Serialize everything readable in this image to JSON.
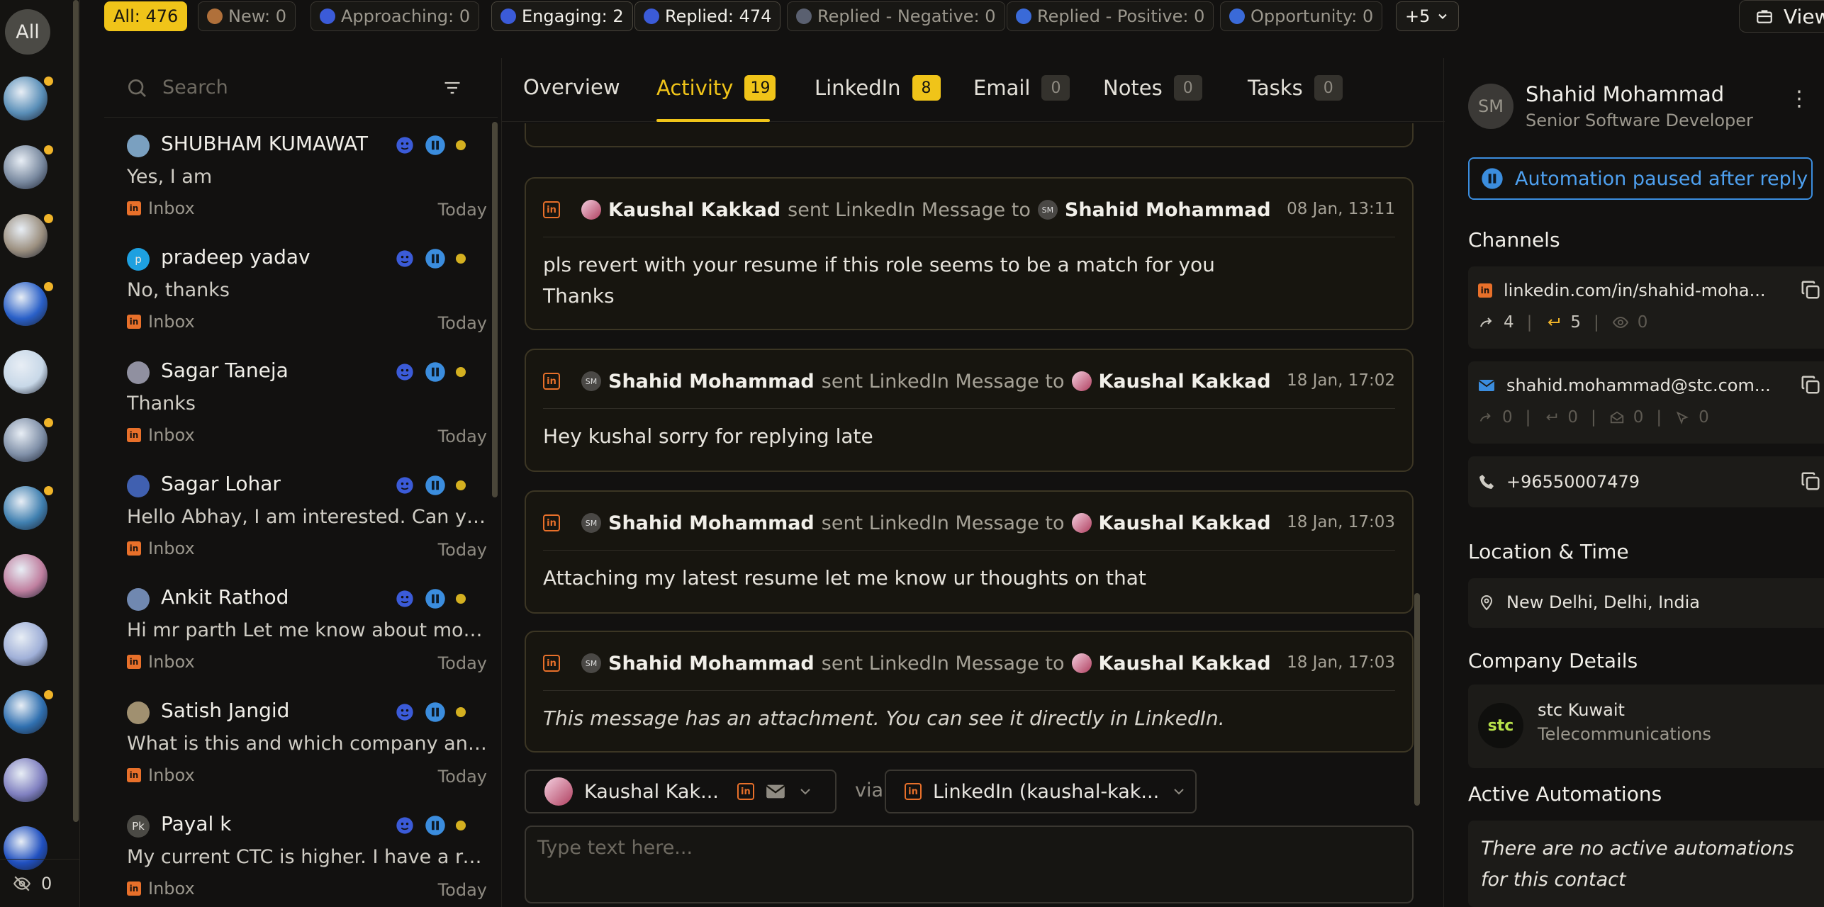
{
  "rail": {
    "all_label": "All",
    "avatars": [
      {
        "color": "#5a8fb8",
        "dot": true
      },
      {
        "color": "#7a8aa0",
        "dot": true
      },
      {
        "color": "#9c9080",
        "dot": true
      },
      {
        "color": "#2a60c8",
        "dot": true
      },
      {
        "color": "#c8d8e8",
        "dot": false
      },
      {
        "color": "#8090a8",
        "dot": true
      },
      {
        "color": "#4080b0",
        "dot": true
      },
      {
        "color": "#c080a0",
        "dot": false
      },
      {
        "color": "#a0b0d8",
        "dot": false
      },
      {
        "color": "#3070b0",
        "dot": true
      },
      {
        "color": "#8080c0",
        "dot": false
      },
      {
        "color": "#2050c0",
        "dot": false
      }
    ],
    "hidden_count": "0"
  },
  "filters": [
    {
      "label": "All: 476",
      "state": "active"
    },
    {
      "label": "New: 0",
      "state": "dim"
    },
    {
      "label": "Approaching: 0",
      "state": "dim"
    },
    {
      "label": "Engaging: 2",
      "state": "bright"
    },
    {
      "label": "Replied: 474",
      "state": "bright"
    },
    {
      "label": "Replied - Negative: 0",
      "state": "dim"
    },
    {
      "label": "Replied - Positive: 0",
      "state": "dim"
    },
    {
      "label": "Opportunity: 0",
      "state": "dim"
    },
    {
      "label": "+5",
      "state": "bright"
    }
  ],
  "crm_button": "View in CRM",
  "search": {
    "placeholder": "Search"
  },
  "conversations": [
    {
      "name": "SHUBHAM KUMAWAT",
      "message": "Yes, I am",
      "source": "Inbox",
      "time": "Today",
      "avatar_color": "#7aa0c0"
    },
    {
      "name": "pradeep yadav",
      "message": "No, thanks",
      "source": "Inbox",
      "time": "Today",
      "avatar_color": "#1ea0e0",
      "initial": "p"
    },
    {
      "name": "Sagar Taneja",
      "message": "Thanks",
      "source": "Inbox",
      "time": "Today",
      "avatar_color": "#9090a0"
    },
    {
      "name": "Sagar Lohar",
      "message": "Hello Abhay, I am interested. Can you share more details?",
      "source": "Inbox",
      "time": "Today",
      "avatar_color": "#4060b0"
    },
    {
      "name": "Ankit Rathod",
      "message": "Hi mr parth Let me know about more details",
      "source": "Inbox",
      "time": "Today",
      "avatar_color": "#7088b0"
    },
    {
      "name": "Satish Jangid",
      "message": "What is this and which company and role is it for?",
      "source": "Inbox",
      "time": "Today",
      "avatar_color": "#a09070"
    },
    {
      "name": "Payal k",
      "message": "My current CTC is higher. I have a role in mind",
      "source": "Inbox",
      "time": "Today",
      "avatar_color": "#4b4a45",
      "initial": "Pk"
    }
  ],
  "tabs": [
    {
      "label": "Overview",
      "count": null,
      "active": false
    },
    {
      "label": "Activity",
      "count": "19",
      "active": true
    },
    {
      "label": "LinkedIn",
      "count": "8",
      "active": false
    },
    {
      "label": "Email",
      "count": "0",
      "active": false
    },
    {
      "label": "Notes",
      "count": "0",
      "active": false
    },
    {
      "label": "Tasks",
      "count": "0",
      "active": false
    }
  ],
  "activity": [
    {
      "from": "Kaushal Kakkad",
      "verb": "sent LinkedIn Message to",
      "to": "Shahid Mohammad",
      "date": "08 Jan, 13:11",
      "from_kind": "kk",
      "to_kind": "sm",
      "body": [
        "pls revert with your resume if this role seems to be a match for you",
        "Thanks"
      ],
      "italic": false
    },
    {
      "from": "Shahid Mohammad",
      "verb": "sent LinkedIn Message to",
      "to": "Kaushal Kakkad",
      "date": "18 Jan, 17:02",
      "from_kind": "sm",
      "to_kind": "kk",
      "body": [
        "Hey kushal sorry for replying late"
      ],
      "italic": false
    },
    {
      "from": "Shahid Mohammad",
      "verb": "sent LinkedIn Message to",
      "to": "Kaushal Kakkad",
      "date": "18 Jan, 17:03",
      "from_kind": "sm",
      "to_kind": "kk",
      "body": [
        "Attaching my latest resume let me know ur thoughts on that"
      ],
      "italic": false
    },
    {
      "from": "Shahid Mohammad",
      "verb": "sent LinkedIn Message to",
      "to": "Kaushal Kakkad",
      "date": "18 Jan, 17:03",
      "from_kind": "sm",
      "to_kind": "kk",
      "body": [
        "This message has an attachment. You can see it directly in LinkedIn."
      ],
      "italic": true
    }
  ],
  "composer": {
    "sender": "Kaushal Kak...",
    "via": "via",
    "channel": "LinkedIn (kaushal-kak...",
    "placeholder": "Type text here..."
  },
  "contact": {
    "initials": "SM",
    "name": "Shahid Mohammad",
    "title": "Senior Software Developer",
    "automation": "Automation paused after reply",
    "channels_title": "Channels",
    "linkedin": "linkedin.com/in/shahid-moha...",
    "linkedin_stats": {
      "sent": "4",
      "replied": "5",
      "viewed": "0"
    },
    "email": "shahid.mohammad@stc.com...",
    "email_stats": {
      "sent": "0",
      "replied": "0",
      "opened": "0",
      "clicked": "0"
    },
    "phone": "+96550007479",
    "location_title": "Location & Time",
    "location": "New Delhi, Delhi, India",
    "company_title": "Company Details",
    "company_name": "stc Kuwait",
    "company_industry": "Telecommunications",
    "company_logo": "stc",
    "automations_title": "Active Automations",
    "automations_empty": "There are no active automations for this contact"
  },
  "colors": {
    "accent": "#f0c419",
    "linkedin": "#e8702a",
    "automation": "#3b8dde",
    "dot": "#f0b429"
  }
}
